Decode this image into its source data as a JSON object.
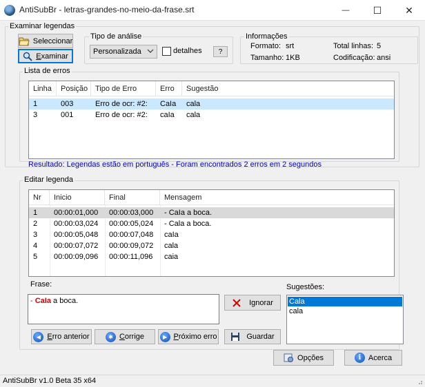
{
  "window": {
    "title": "AntiSubBr - letras-grandes-no-meio-da-frase.srt",
    "minimize": "—",
    "maximize": "☐",
    "close": "✕"
  },
  "examine": {
    "group_label": "Examinar legendas",
    "select_button": "Seleccionar",
    "examine_button_underlined": "E",
    "examine_button_rest": "xaminar"
  },
  "analysis": {
    "group_label": "Tipo de análise",
    "selected": "Personalizada",
    "details_label": "detalhes",
    "details_checked": false,
    "help_button": "?"
  },
  "info": {
    "group_label": "Informações",
    "format_label": "Formato:",
    "format_value": "srt",
    "size_label": "Tamanho:",
    "size_value": "1KB",
    "lines_label": "Total linhas:",
    "lines_value": "5",
    "encoding_label": "Codificação:",
    "encoding_value": "ansi"
  },
  "errors": {
    "group_label": "Lista de erros",
    "columns": [
      "Linha",
      "Posição",
      "Tipo de Erro",
      "Erro",
      "Sugestão"
    ],
    "rows": [
      {
        "line": "1",
        "position": "003",
        "type": "Erro de ocr: #2:",
        "error": "CaIa",
        "suggestion": "cala"
      },
      {
        "line": "3",
        "position": "001",
        "type": "Erro de ocr: #2:",
        "error": "caIa",
        "suggestion": "cala"
      }
    ],
    "result": "Resultado: Legendas estão em português - Foram encontrados 2 erros em 2 segundos"
  },
  "edit": {
    "group_label": "Editar legenda",
    "columns": [
      "Nr",
      "Inicio",
      "Final",
      "Mensagem"
    ],
    "rows": [
      {
        "nr": "1",
        "start": "00:00:01,000",
        "end": "00:00:03,000",
        "message": "- CaIa a boca."
      },
      {
        "nr": "2",
        "start": "00:00:03,024",
        "end": "00:00:05,024",
        "message": "- Cala a boca."
      },
      {
        "nr": "3",
        "start": "00:00:05,048",
        "end": "00:00:07,048",
        "message": "caIa"
      },
      {
        "nr": "4",
        "start": "00:00:07,072",
        "end": "00:00:09,072",
        "message": "cala"
      },
      {
        "nr": "5",
        "start": "00:00:09,096",
        "end": "00:00:11,096",
        "message": "caia"
      }
    ],
    "phrase_label": "Frase:",
    "phrase_prefix": "- ",
    "phrase_error": "CaIa",
    "phrase_suffix": " a boca.",
    "ignore_button": "Ignorar",
    "suggestions_label": "Sugestões:",
    "suggestions": [
      "Cala",
      "cala"
    ],
    "prev_button_underlined": "E",
    "prev_button_rest": "rro anterior",
    "fix_button_underlined": "C",
    "fix_button_rest": "orrige",
    "next_button_underlined": "P",
    "next_button_rest": "róximo erro",
    "save_button": "Guardar"
  },
  "footer": {
    "options_button": "Opções",
    "about_button": "Acerca",
    "status": "AntiSubBr v1.0 Beta 35 x64"
  },
  "colors": {
    "accent": "#0078d7",
    "result_text": "#0000c8",
    "error_text": "#d40000",
    "selected_row": "#cce8ff"
  }
}
